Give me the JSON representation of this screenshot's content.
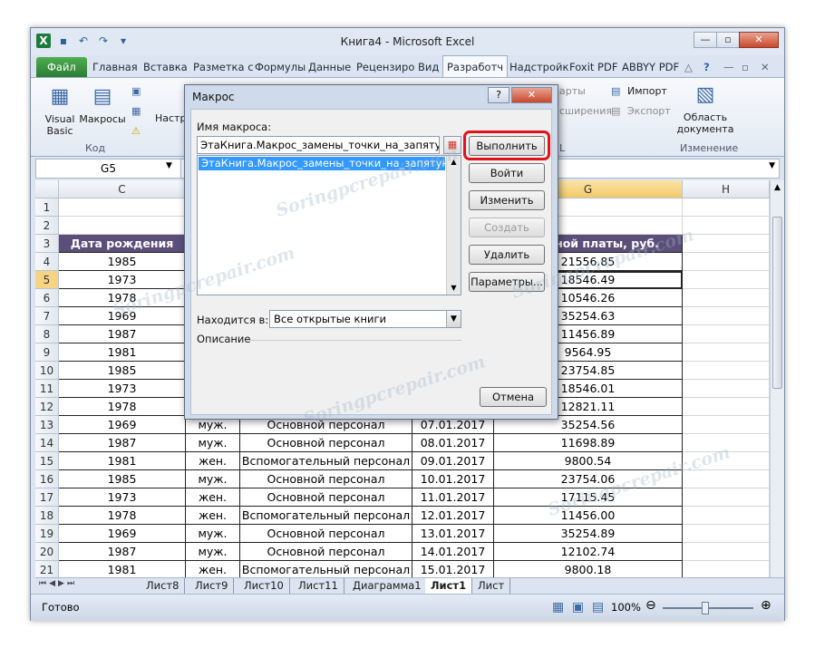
{
  "window": {
    "title": "Книга4  -  Microsoft Excel"
  },
  "ribbon_tabs": [
    "Файл",
    "Главная",
    "Вставка",
    "Разметка с",
    "Формулы",
    "Данные",
    "Рецензиро",
    "Вид",
    "Разработч",
    "Надстройк",
    "Foxit PDF",
    "ABBYY PDF"
  ],
  "ribbon": {
    "visual_basic": "Visual Basic",
    "macros": "Макросы",
    "settings": "Настр",
    "group_code": "Код",
    "item_carts": "арты",
    "item_ext": "сширения",
    "import": "Импорт",
    "export": "Экспорт",
    "group_l": "L",
    "doc_area": "Область документа",
    "group_change": "Изменение"
  },
  "formula_bar": {
    "name_box": "G5"
  },
  "columns": {
    "c": "C",
    "g": "G",
    "h": "H"
  },
  "rows": [
    {
      "n": "1",
      "c": "",
      "d": "",
      "e": "",
      "f": "",
      "g": ""
    },
    {
      "n": "2",
      "c": "",
      "d": "",
      "e": "",
      "f": "",
      "g": ""
    },
    {
      "n": "3",
      "c": "Дата рождения",
      "d": "",
      "e": "",
      "f": "",
      "g": "работной платы, руб."
    },
    {
      "n": "4",
      "c": "1985",
      "d": "",
      "e": "",
      "f": "",
      "g": "21556.85"
    },
    {
      "n": "5",
      "c": "1973",
      "d": "",
      "e": "",
      "f": "",
      "g": "18546.49"
    },
    {
      "n": "6",
      "c": "1978",
      "d": "",
      "e": "",
      "f": "",
      "g": "10546.26"
    },
    {
      "n": "7",
      "c": "1969",
      "d": "",
      "e": "",
      "f": "",
      "g": "35254.63"
    },
    {
      "n": "8",
      "c": "1987",
      "d": "",
      "e": "",
      "f": "",
      "g": "11456.89"
    },
    {
      "n": "9",
      "c": "1981",
      "d": "",
      "e": "",
      "f": "",
      "g": "9564.95"
    },
    {
      "n": "10",
      "c": "1985",
      "d": "",
      "e": "",
      "f": "",
      "g": "23754.85"
    },
    {
      "n": "11",
      "c": "1973",
      "d": "",
      "e": "",
      "f": "",
      "g": "18546.01"
    },
    {
      "n": "12",
      "c": "1978",
      "d": "",
      "e": "",
      "f": "",
      "g": "12821.11"
    },
    {
      "n": "13",
      "c": "1969",
      "d": "муж.",
      "e": "Основной персонал",
      "f": "07.01.2017",
      "g": "35254.56"
    },
    {
      "n": "14",
      "c": "1987",
      "d": "муж.",
      "e": "Основной персонал",
      "f": "08.01.2017",
      "g": "11698.89"
    },
    {
      "n": "15",
      "c": "1981",
      "d": "жен.",
      "e": "Вспомогательный персонал",
      "f": "09.01.2017",
      "g": "9800.54"
    },
    {
      "n": "16",
      "c": "1985",
      "d": "муж.",
      "e": "Основной персонал",
      "f": "10.01.2017",
      "g": "23754.06"
    },
    {
      "n": "17",
      "c": "1973",
      "d": "жен.",
      "e": "Основной персонал",
      "f": "11.01.2017",
      "g": "17115.45"
    },
    {
      "n": "18",
      "c": "1978",
      "d": "жен.",
      "e": "Вспомогательный персонал",
      "f": "12.01.2017",
      "g": "11456.00"
    },
    {
      "n": "19",
      "c": "1969",
      "d": "муж.",
      "e": "Основной персонал",
      "f": "13.01.2017",
      "g": "35254.89"
    },
    {
      "n": "20",
      "c": "1987",
      "d": "муж.",
      "e": "Основной персонал",
      "f": "14.01.2017",
      "g": "12102.74"
    },
    {
      "n": "21",
      "c": "1981",
      "d": "жен.",
      "e": "Вспомогательный персонал",
      "f": "15.01.2017",
      "g": "9800.18"
    }
  ],
  "sheet_tabs": [
    "Лист8",
    "Лист9",
    "Лист10",
    "Лист11",
    "Диаграмма1",
    "Лист1",
    "Лист"
  ],
  "status": {
    "ready": "Готово",
    "zoom": "100%"
  },
  "dialog": {
    "title": "Макрос",
    "help": "?",
    "close": "✕",
    "name_label": "Имя макроса:",
    "name_value": "ЭтаКнига.Макрос_замены_точки_на_запятую",
    "list_item": "ЭтаКнига.Макрос_замены_точки_на_запятую",
    "in_label": "Находится в:",
    "in_value": "Все открытые книги",
    "desc_label": "Описание",
    "buttons": {
      "run": "Выполнить",
      "step": "Войти",
      "edit": "Изменить",
      "create": "Создать",
      "delete": "Удалить",
      "options": "Параметры...",
      "cancel": "Отмена"
    }
  },
  "watermark": "Soringpcrepair.com"
}
